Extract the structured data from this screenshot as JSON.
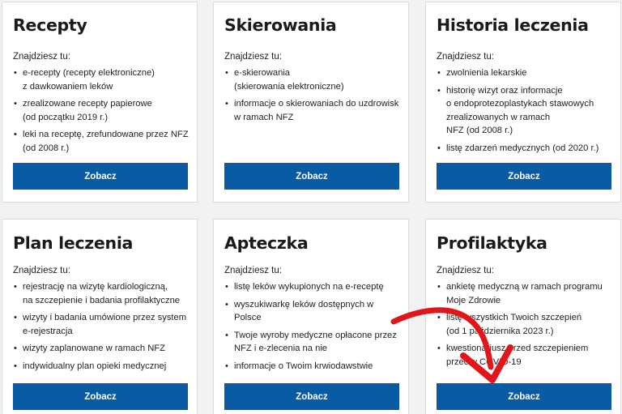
{
  "intro_label": "Znajdziesz tu:",
  "button_label": "Zobacz",
  "accent_color": "#0b5aa4",
  "arrow_color": "#e0161b",
  "cards": [
    {
      "title": "Recepty",
      "items": [
        "e-recepty (recepty elektroniczne)\nz dawkowaniem leków",
        "zrealizowane recepty papierowe\n(od początku 2019 r.)",
        "leki na receptę, zrefundowane przez NFZ\n(od 2008 r.)"
      ]
    },
    {
      "title": "Skierowania",
      "items": [
        "e-skierowania\n(skierowania elektroniczne)",
        "informacje o skierowaniach do uzdrowisk\nw ramach NFZ"
      ]
    },
    {
      "title": "Historia leczenia",
      "items": [
        "zwolnienia lekarskie",
        "historię wizyt oraz informacje\no endoprotezoplastykach stawowych\nzrealizowanych w ramach\nNFZ (od 2008 r.)",
        "listę zdarzeń medycznych (od 2020 r.)"
      ]
    },
    {
      "title": "Plan leczenia",
      "items": [
        "rejestrację na wizytę kardiologiczną,\nna szczepienie i badania profilaktyczne",
        "wizyty i badania umówione przez system\ne-rejestracja",
        "wizyty zaplanowane w ramach NFZ",
        "indywidualny plan opieki medycznej"
      ]
    },
    {
      "title": "Apteczka",
      "items": [
        "listę leków wykupionych na e-receptę",
        "wyszukiwarkę leków dostępnych w Polsce",
        "Twoje wyroby medyczne opłacone przez\nNFZ i e-zlecenia na nie",
        "informacje o Twoim krwiodawstwie"
      ]
    },
    {
      "title": "Profilaktyka",
      "items": [
        "ankietę medyczną w ramach programu\nMoje Zdrowie",
        "listę wszystkich Twoich szczepień\n(od 1 października 2023 r.)",
        "kwestionariusz przed szczepieniem\nprzeciw COVID-19"
      ]
    }
  ]
}
